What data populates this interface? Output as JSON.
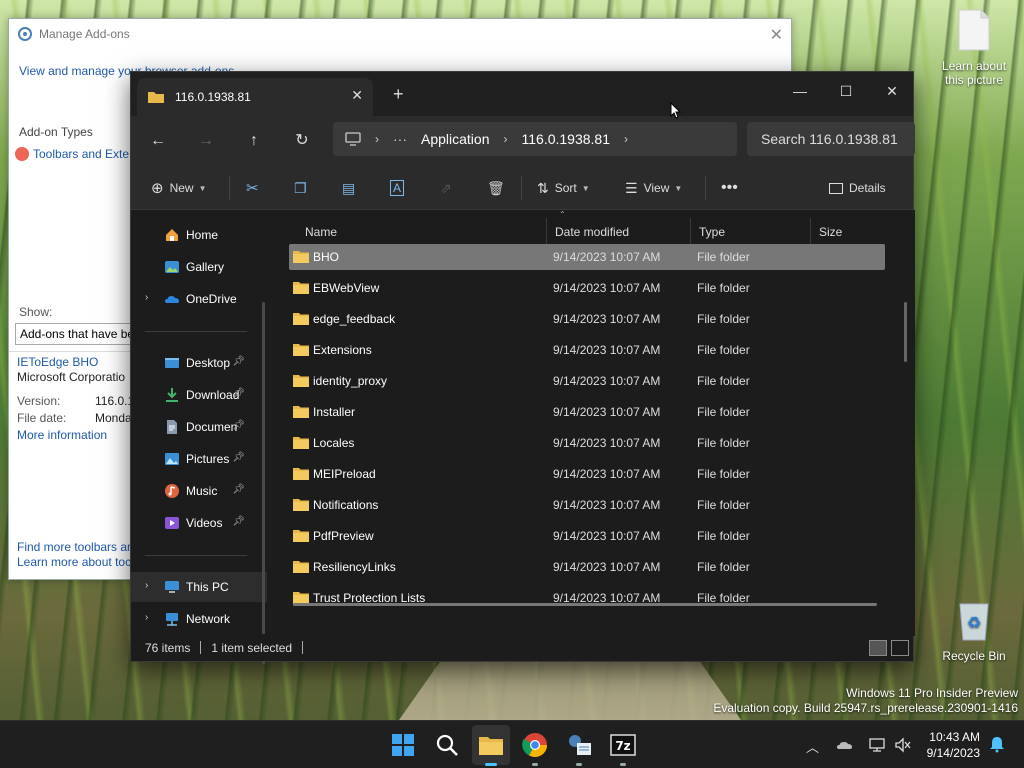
{
  "desktop": {
    "learn_about": "Learn about\nthis picture",
    "learn_line1": "Learn about",
    "learn_line2": "this picture",
    "recycle_bin": "Recycle Bin"
  },
  "addons": {
    "title": "Manage Add-ons",
    "subtitle": "View and manage your browser add-ons",
    "addon_types_label": "Add-on Types",
    "toolbars_item": "Toolbars and Exte",
    "show_label": "Show:",
    "show_value": "Add-ons that have be",
    "addon_name": "IEToEdge BHO",
    "addon_company": "Microsoft Corporatio",
    "version_label": "Version:",
    "version_value": "116.0.1",
    "filedate_label": "File date:",
    "filedate_value": "Monda",
    "more_info": "More information",
    "find_more": "Find more toolbars ar",
    "learn_more": "Learn more about toc"
  },
  "explorer": {
    "tab_title": "116.0.1938.81",
    "breadcrumb": [
      "Application",
      "116.0.1938.81"
    ],
    "search_placeholder": "Search 116.0.1938.81",
    "toolbar": {
      "new": "New",
      "sort": "Sort",
      "view": "View",
      "details": "Details"
    },
    "nav": {
      "home": "Home",
      "gallery": "Gallery",
      "onedrive": "OneDrive",
      "desktop": "Desktop",
      "downloads": "Download",
      "documents": "Documen",
      "pictures": "Pictures",
      "music": "Music",
      "videos": "Videos",
      "this_pc": "This PC",
      "network": "Network"
    },
    "columns": {
      "name": "Name",
      "date": "Date modified",
      "type": "Type",
      "size": "Size"
    },
    "files": [
      {
        "name": "BHO",
        "date": "9/14/2023 10:07 AM",
        "type": "File folder",
        "selected": true
      },
      {
        "name": "EBWebView",
        "date": "9/14/2023 10:07 AM",
        "type": "File folder"
      },
      {
        "name": "edge_feedback",
        "date": "9/14/2023 10:07 AM",
        "type": "File folder"
      },
      {
        "name": "Extensions",
        "date": "9/14/2023 10:07 AM",
        "type": "File folder"
      },
      {
        "name": "identity_proxy",
        "date": "9/14/2023 10:07 AM",
        "type": "File folder"
      },
      {
        "name": "Installer",
        "date": "9/14/2023 10:07 AM",
        "type": "File folder"
      },
      {
        "name": "Locales",
        "date": "9/14/2023 10:07 AM",
        "type": "File folder"
      },
      {
        "name": "MEIPreload",
        "date": "9/14/2023 10:07 AM",
        "type": "File folder"
      },
      {
        "name": "Notifications",
        "date": "9/14/2023 10:07 AM",
        "type": "File folder"
      },
      {
        "name": "PdfPreview",
        "date": "9/14/2023 10:07 AM",
        "type": "File folder"
      },
      {
        "name": "ResiliencyLinks",
        "date": "9/14/2023 10:07 AM",
        "type": "File folder"
      },
      {
        "name": "Trust Protection Lists",
        "date": "9/14/2023 10:07 AM",
        "type": "File folder"
      }
    ],
    "status_items": "76 items",
    "status_selected": "1 item selected"
  },
  "watermark": {
    "line1": "Windows 11 Pro Insider Preview",
    "line2": "Evaluation copy. Build 25947.rs_prerelease.230901-1416"
  },
  "taskbar": {
    "time": "10:43 AM",
    "date": "9/14/2023"
  },
  "colors": {
    "folder": "#e8b84a",
    "accent": "#4cc2ff",
    "selection": "#777777"
  }
}
